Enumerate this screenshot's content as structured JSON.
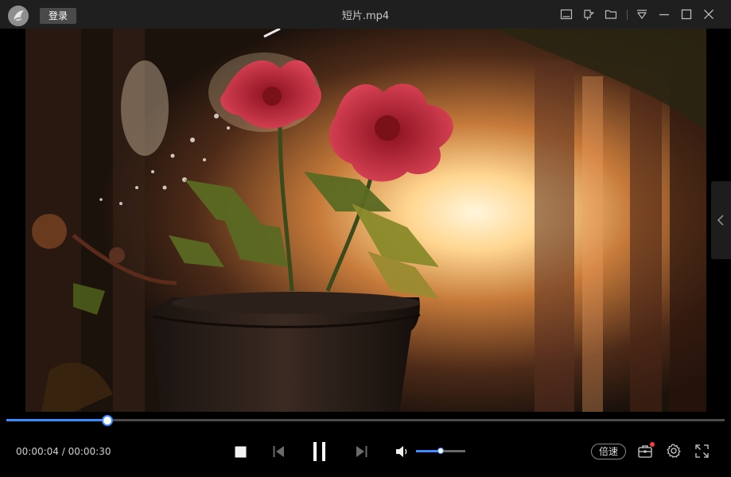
{
  "titlebar": {
    "login_label": "登录",
    "window_title": "短片.mp4",
    "icons": [
      "mini-player-icon",
      "pin-icon",
      "folder-icon",
      "menu-icon",
      "minimize-icon",
      "maximize-icon",
      "close-icon"
    ]
  },
  "player": {
    "current_time": "00:00:04",
    "separator": " / ",
    "total_time": "00:00:30",
    "progress_fraction": 0.1395,
    "volume_fraction": 0.5,
    "speed_label": "倍速",
    "state": "playing"
  },
  "colors": {
    "accent": "#3d8bff",
    "titlebar_bg": "#1f1f1f",
    "notification_dot": "#ff3b3b"
  }
}
